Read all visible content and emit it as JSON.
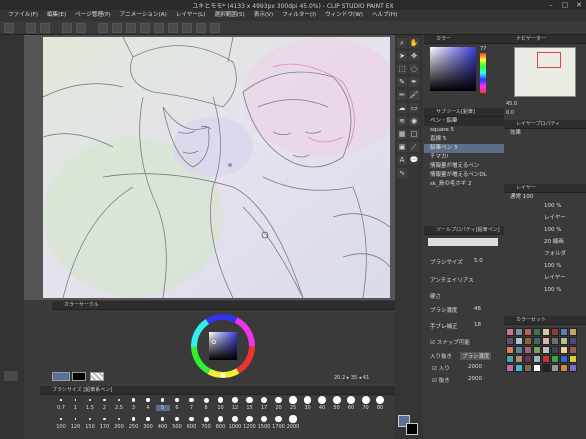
{
  "window": {
    "title": "ユキとモモ* (4133 x 4993px 300dpi 45.0%) - CLIP STUDIO PAINT EX"
  },
  "menu": [
    "ファイル(F)",
    "編集(E)",
    "ページ管理(P)",
    "アニメーション(A)",
    "レイヤー(L)",
    "選択範囲(S)",
    "表示(V)",
    "フィルター(I)",
    "ウィンドウ(W)",
    "ヘルプ(H)"
  ],
  "panels": {
    "color_wheel": {
      "title": "カラーサークル"
    },
    "brush_size": {
      "title": "ブラシサイズ [鉛筆系ペン]",
      "row1": [
        "0.7",
        "1",
        "1.5",
        "2",
        "2.5",
        "3",
        "4",
        "5",
        "6",
        "7",
        "8",
        "10",
        "12",
        "15",
        "17",
        "20",
        "25",
        "30",
        "40",
        "50",
        "60",
        "70",
        "80"
      ],
      "row2": [
        "100",
        "120",
        "150",
        "170",
        "200",
        "250",
        "300",
        "400",
        "500",
        "600",
        "700",
        "800",
        "1000",
        "1200",
        "1500",
        "1700",
        "2000"
      ],
      "selected": "5"
    },
    "color_slider": {
      "title": "カラー",
      "value": "77"
    },
    "sub_tool": {
      "title": "サブツール[鉛筆]",
      "tab": "ペン・鉛筆",
      "items": [
        "square 5",
        "直線 5",
        "鉛筆ペン 3",
        "チマカ!",
        "情報量が増えるペン",
        "情報量が増えるペンDL",
        "sk_鳥の毛ホギ 2"
      ],
      "selected": 2
    },
    "tool_prop": {
      "title": "ツールプロパティ[鉛筆ペン]",
      "brush_size_label": "ブラシサイズ",
      "brush_size_val": "5.0",
      "aa_label": "アンチエイリアス",
      "hardness_label": "硬さ",
      "density_label": "ブラシ濃度",
      "density_val": "46",
      "stab_label": "手ブレ補正",
      "stab_val": "18",
      "snap_label": "スナップ可能",
      "inout_label": "入り抜き",
      "brush_density": "ブラシ濃度",
      "in_label": "入り",
      "in_val": "2000",
      "out_label": "抜き",
      "out_val": "2000"
    },
    "navigator": {
      "title": "ナビゲーター",
      "zoom": "45.0",
      "angle": "0.0"
    },
    "layer_prop": {
      "title": "レイヤープロパティ",
      "effect": "効果"
    },
    "layer": {
      "title": "レイヤー",
      "blend": "通常",
      "opacity": "100",
      "layers": [
        "100 %",
        "レイヤー",
        "100 %",
        "20 線画",
        "フォルダ",
        "100 %",
        "レイヤー",
        "100 %"
      ]
    },
    "colorset": {
      "title": "カラーセット"
    }
  },
  "status": {
    "zoom": "20.2",
    "angle": "35",
    "extra": "41"
  },
  "colors": {
    "accent": "#5b6f8a",
    "swatches": [
      "#c47a8a",
      "#7b8fa0",
      "#b5605a",
      "#4c6d55",
      "#d6c9a8",
      "#8b3b3b",
      "#5a7fb5",
      "#c9a06a",
      "#6b4d6b",
      "#a8c7d6",
      "#9b5c3a",
      "#3a6b6b",
      "#e0b0b0",
      "#707070",
      "#b0c090",
      "#4a4a7a",
      "#d08060",
      "#6080a0",
      "#a06080",
      "#80a060",
      "#c0c0c0",
      "#404060",
      "#e8d0a0",
      "#906050",
      "#50a0b0",
      "#b09070",
      "#703050",
      "#a0b0d0",
      "#cc3333",
      "#33aa44",
      "#3366cc",
      "#ddcc33",
      "#cc66aa",
      "#44bbcc",
      "#886644",
      "#ffffff",
      "#222222",
      "#999999",
      "#cc8844",
      "#8866cc"
    ]
  }
}
